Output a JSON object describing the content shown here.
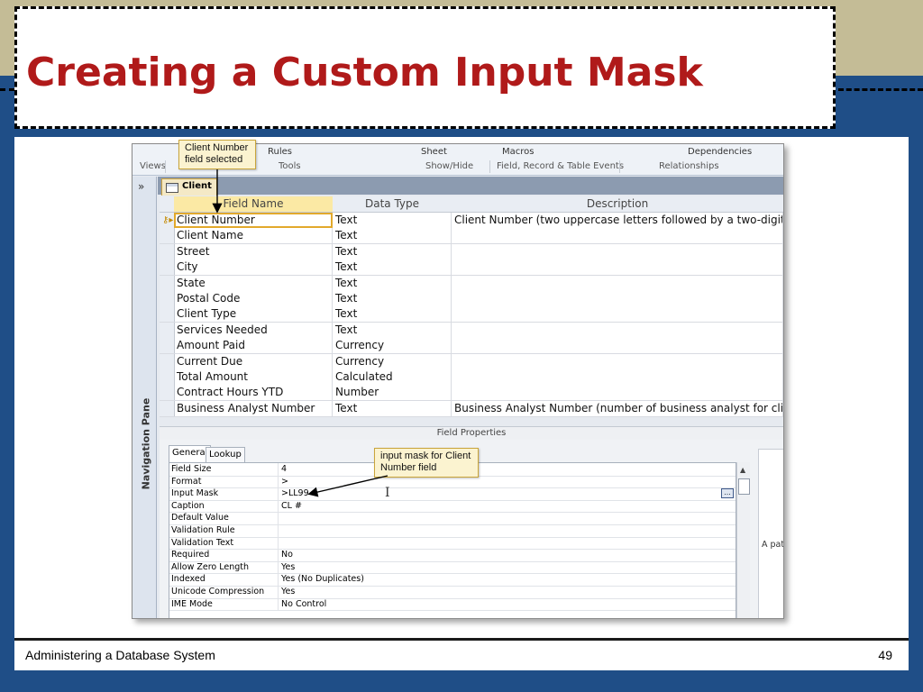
{
  "slide": {
    "title": "Creating a Custom Input Mask",
    "footer_left": "Administering a Database System",
    "page_number": "49"
  },
  "ribbon": {
    "items_top": [
      "Rules",
      "Sheet",
      "Macros",
      "Dependencies"
    ],
    "groups": [
      "Views",
      "Tools",
      "Show/Hide",
      "Field, Record & Table Events",
      "Relationships"
    ]
  },
  "nav": {
    "label": "Navigation Pane",
    "chevron": "»"
  },
  "tab": {
    "label": "Client"
  },
  "grid": {
    "headers": [
      "Field Name",
      "Data Type",
      "Description"
    ],
    "rows": [
      {
        "name": "Client Number",
        "type": "Text",
        "desc": "Client Number (two uppercase letters followed by a two-digit n"
      },
      {
        "name": "Client Name",
        "type": "Text",
        "desc": ""
      },
      {
        "name": "Street",
        "type": "Text",
        "desc": ""
      },
      {
        "name": "City",
        "type": "Text",
        "desc": ""
      },
      {
        "name": "State",
        "type": "Text",
        "desc": ""
      },
      {
        "name": "Postal Code",
        "type": "Text",
        "desc": ""
      },
      {
        "name": "Client Type",
        "type": "Text",
        "desc": ""
      },
      {
        "name": "Services Needed",
        "type": "Text",
        "desc": ""
      },
      {
        "name": "Amount Paid",
        "type": "Currency",
        "desc": ""
      },
      {
        "name": "Current Due",
        "type": "Currency",
        "desc": ""
      },
      {
        "name": "Total Amount",
        "type": "Calculated",
        "desc": ""
      },
      {
        "name": "Contract Hours YTD",
        "type": "Number",
        "desc": ""
      },
      {
        "name": "Business Analyst Number",
        "type": "Text",
        "desc": "Business Analyst Number (number of business analyst for client"
      }
    ]
  },
  "field_properties": {
    "title": "Field Properties",
    "tabs": [
      "General",
      "Lookup"
    ],
    "rows": [
      {
        "name": "Field Size",
        "value": "4"
      },
      {
        "name": "Format",
        "value": ">"
      },
      {
        "name": "Input Mask",
        "value": ">LL99"
      },
      {
        "name": "Caption",
        "value": "CL #"
      },
      {
        "name": "Default Value",
        "value": ""
      },
      {
        "name": "Validation Rule",
        "value": ""
      },
      {
        "name": "Validation Text",
        "value": ""
      },
      {
        "name": "Required",
        "value": "No"
      },
      {
        "name": "Allow Zero Length",
        "value": "Yes"
      },
      {
        "name": "Indexed",
        "value": "Yes (No Duplicates)"
      },
      {
        "name": "Unicode Compression",
        "value": "Yes"
      },
      {
        "name": "IME Mode",
        "value": "No Control"
      }
    ],
    "help_text": "A pat",
    "build_button": "..."
  },
  "callouts": {
    "client_number": "Client Number field selected",
    "input_mask": "input mask for Client Number field"
  }
}
